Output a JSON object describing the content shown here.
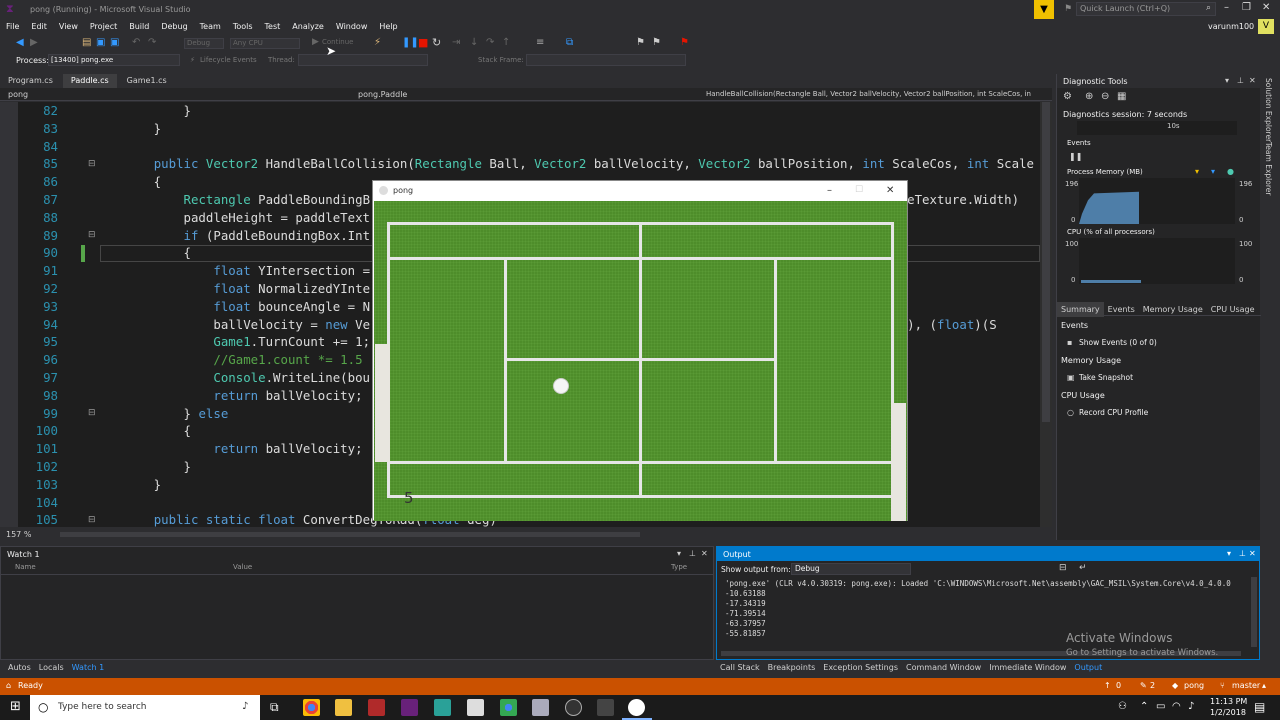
{
  "window": {
    "title": "pong (Running) - Microsoft Visual Studio",
    "quick_launch": "Quick Launch (Ctrl+Q)",
    "user": "varunm100",
    "user_initial": "V"
  },
  "menu": [
    "File",
    "Edit",
    "View",
    "Project",
    "Build",
    "Debug",
    "Team",
    "Tools",
    "Test",
    "Analyze",
    "Window",
    "Help"
  ],
  "toolbar": {
    "config": "Debug",
    "platform": "Any CPU",
    "continue": "Continue"
  },
  "procbar": {
    "process_label": "Process:",
    "process": "[13400] pong.exe",
    "lifecycle": "Lifecycle Events",
    "thread": "Thread:",
    "stack": "Stack Frame:"
  },
  "tabs": [
    {
      "label": "Program.cs",
      "active": false
    },
    {
      "label": "Paddle.cs",
      "active": true
    },
    {
      "label": "Game1.cs",
      "active": false
    }
  ],
  "nav": {
    "project": "pong",
    "class": "pong.Paddle",
    "method": "HandleBallCollision(Rectangle Ball, Vector2 ballVelocity, Vector2 ballPosition, int ScaleCos, in"
  },
  "code": [
    {
      "n": "82",
      "t": "            }"
    },
    {
      "n": "83",
      "t": "        }"
    },
    {
      "n": "84",
      "t": ""
    },
    {
      "n": "85",
      "t": "        public Vector2 HandleBallCollision(Rectangle Ball, Vector2 ballVelocity, Vector2 ballPosition, int ScaleCos, int Scale"
    },
    {
      "n": "86",
      "t": "        {"
    },
    {
      "n": "87",
      "t": "            Rectangle PaddleBoundingB                                                                     ddleTexture.Width)"
    },
    {
      "n": "88",
      "t": "            paddleHeight = paddleText"
    },
    {
      "n": "89",
      "t": "            if (PaddleBoundingBox.Int"
    },
    {
      "n": "90",
      "t": "            {"
    },
    {
      "n": "91",
      "t": "                float YIntersection ="
    },
    {
      "n": "92",
      "t": "                float NormalizedYInte"
    },
    {
      "n": "93",
      "t": "                float bounceAngle = N"
    },
    {
      "n": "94",
      "t": "                ballVelocity = new Ve                                                                  ngle))), (float)(S"
    },
    {
      "n": "95",
      "t": "                Game1.TurnCount += 1;"
    },
    {
      "n": "96",
      "t": "                //Game1.count *= 1.5"
    },
    {
      "n": "97",
      "t": "                Console.WriteLine(bou"
    },
    {
      "n": "98",
      "t": "                return ballVelocity;"
    },
    {
      "n": "99",
      "t": "            } else"
    },
    {
      "n": "100",
      "t": "            {"
    },
    {
      "n": "101",
      "t": "                return ballVelocity;"
    },
    {
      "n": "102",
      "t": "            }"
    },
    {
      "n": "103",
      "t": "        }"
    },
    {
      "n": "104",
      "t": ""
    },
    {
      "n": "105",
      "t": "        public static float ConvertDegToRad(float deg)"
    }
  ],
  "zoom": "157 %",
  "game": {
    "title": "pong",
    "score": "5"
  },
  "diag": {
    "title": "Diagnostic Tools",
    "session": "Diagnostics session: 7 seconds",
    "tick": "10s",
    "events": "Events",
    "memory": "Process Memory (MB)",
    "mem_max": "196",
    "mem_min": "0",
    "cpu": "CPU (% of all processors)",
    "cpu_max": "100",
    "cpu_min": "0",
    "tabs": [
      "Summary",
      "Events",
      "Memory Usage",
      "CPU Usage"
    ],
    "sec_events": "Events",
    "show_events": "Show Events (0 of 0)",
    "sec_memory": "Memory Usage",
    "snapshot": "Take Snapshot",
    "sec_cpu": "CPU Usage",
    "cpu_profile": "Record CPU Profile"
  },
  "side": [
    "Solution Explorer",
    "Team Explorer"
  ],
  "watch": {
    "title": "Watch 1",
    "col_name": "Name",
    "col_value": "Value",
    "col_type": "Type"
  },
  "output": {
    "title": "Output",
    "show_from": "Show output from:",
    "source": "Debug",
    "lines": [
      "'pong.exe' (CLR v4.0.30319: pong.exe): Loaded 'C:\\WINDOWS\\Microsoft.Net\\assembly\\GAC_MSIL\\System.Core\\v4.0_4.0.0",
      "-10.63188",
      "-17.34319",
      "-71.39514",
      "-63.37957",
      "-55.81857"
    ]
  },
  "activate": {
    "line1": "Activate Windows",
    "line2": "Go to Settings to activate Windows."
  },
  "bottom_left_tabs": [
    "Autos",
    "Locals",
    "Watch 1"
  ],
  "bottom_right_tabs": [
    "Call Stack",
    "Breakpoints",
    "Exception Settings",
    "Command Window",
    "Immediate Window",
    "Output"
  ],
  "status": {
    "text": "Ready",
    "errors": "0",
    "warnings": "2",
    "project": "pong",
    "branch": "master"
  },
  "taskbar": {
    "search": "Type here to search",
    "time": "11:13 PM",
    "date": "1/2/2018"
  },
  "colors": {
    "accent": "#007acc",
    "status": "#ca5100",
    "keyword": "#569cd6",
    "type": "#4ec9b0",
    "comment": "#57a64a"
  }
}
